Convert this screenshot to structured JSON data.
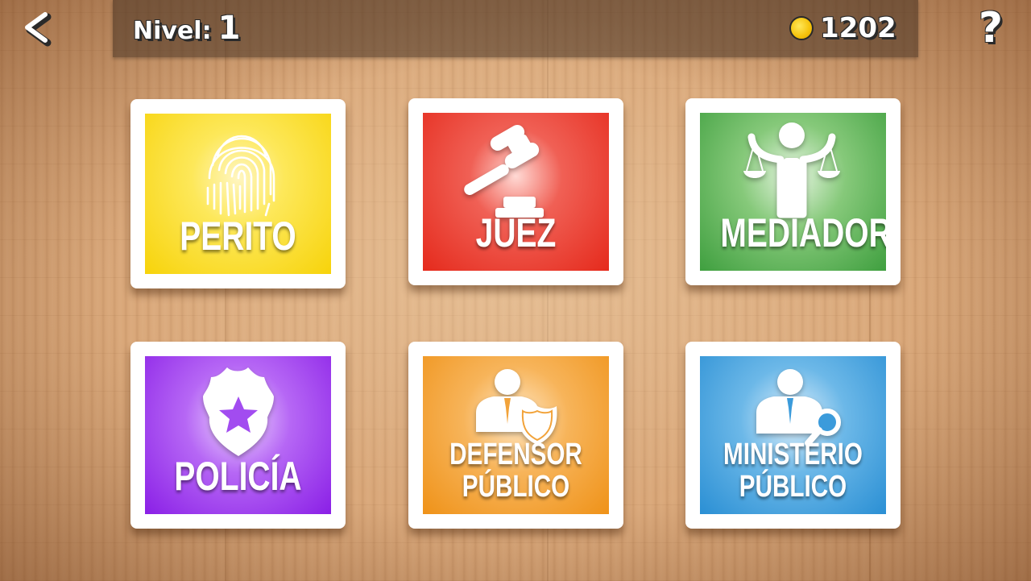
{
  "header": {
    "back_icon": "back-arrow-icon",
    "help_label": "?",
    "level_label": "Nivel:",
    "level_value": "1",
    "coin_icon": "coin-icon",
    "coins": "1202"
  },
  "cards": [
    {
      "id": "perito",
      "label": "PERITO",
      "icon": "fingerprint-icon",
      "color": "#f7d30a"
    },
    {
      "id": "juez",
      "label": "JUEZ",
      "icon": "gavel-icon",
      "color": "#e52a1c"
    },
    {
      "id": "mediador",
      "label": "MEDIADOR",
      "icon": "mediator-scales-icon",
      "color": "#3f9f3f"
    },
    {
      "id": "policia",
      "label": "POLICÍA",
      "icon": "police-badge-icon",
      "color": "#8a1fe6"
    },
    {
      "id": "defensor",
      "label_line1": "DEFENSOR",
      "label_line2": "PÚBLICO",
      "icon": "defender-shield-icon",
      "color": "#ef9218"
    },
    {
      "id": "ministerio",
      "label_line1": "MINISTERIO",
      "label_line2": "PÚBLICO",
      "icon": "prosecutor-magnifier-icon",
      "color": "#2a8fd4"
    }
  ]
}
